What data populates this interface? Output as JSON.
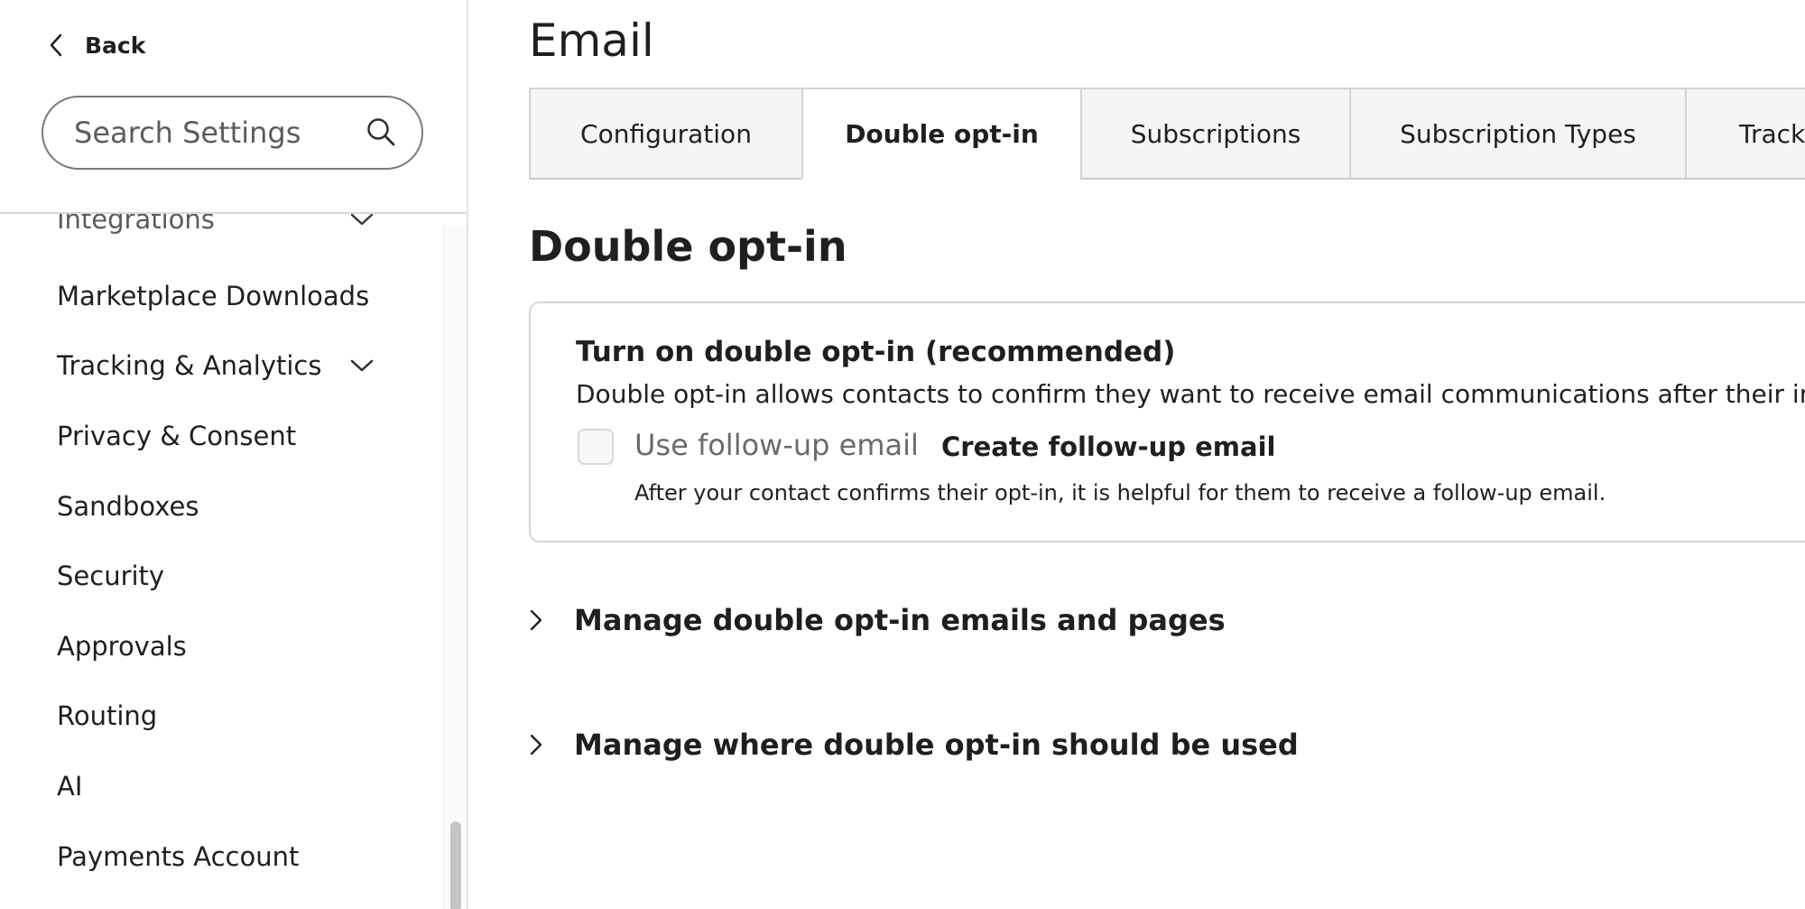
{
  "sidebar": {
    "back_label": "Back",
    "search": {
      "placeholder": "Search Settings",
      "value": ""
    },
    "items": [
      {
        "label": "Integrations",
        "expandable": true
      },
      {
        "label": "Marketplace Downloads",
        "expandable": false
      },
      {
        "label": "Tracking & Analytics",
        "expandable": true
      },
      {
        "label": "Privacy & Consent",
        "expandable": false
      },
      {
        "label": "Sandboxes",
        "expandable": false
      },
      {
        "label": "Security",
        "expandable": false
      },
      {
        "label": "Approvals",
        "expandable": false
      },
      {
        "label": "Routing",
        "expandable": false
      },
      {
        "label": "AI",
        "expandable": false
      },
      {
        "label": "Payments Account",
        "expandable": false
      }
    ]
  },
  "main": {
    "title": "Email",
    "tabs": [
      {
        "label": "Configuration",
        "active": false
      },
      {
        "label": "Double opt-in",
        "active": true
      },
      {
        "label": "Subscriptions",
        "active": false
      },
      {
        "label": "Subscription Types",
        "active": false
      },
      {
        "label": "Track",
        "active": false
      }
    ],
    "section_title": "Double opt-in",
    "card": {
      "title": "Turn on double opt-in (recommended)",
      "description": "Double opt-in allows contacts to confirm they want to receive email communications after their initial",
      "checkbox_label": "Use follow-up email",
      "checkbox_checked": false,
      "create_link": "Create follow-up email",
      "help_text": "After your contact confirms their opt-in, it is helpful for them to receive a follow-up email."
    },
    "accordions": [
      {
        "label": "Manage double opt-in emails and pages"
      },
      {
        "label": "Manage where double opt-in should be used"
      }
    ]
  },
  "colors": {
    "text": "#1f1f1f",
    "muted_text": "#6b6b6b",
    "border": "#d6d6d6",
    "tab_background": "#f5f5f5"
  },
  "icons": {
    "back": "chevron-left-icon",
    "search": "search-icon",
    "expand": "chevron-down-icon",
    "accordion": "chevron-right-icon"
  }
}
